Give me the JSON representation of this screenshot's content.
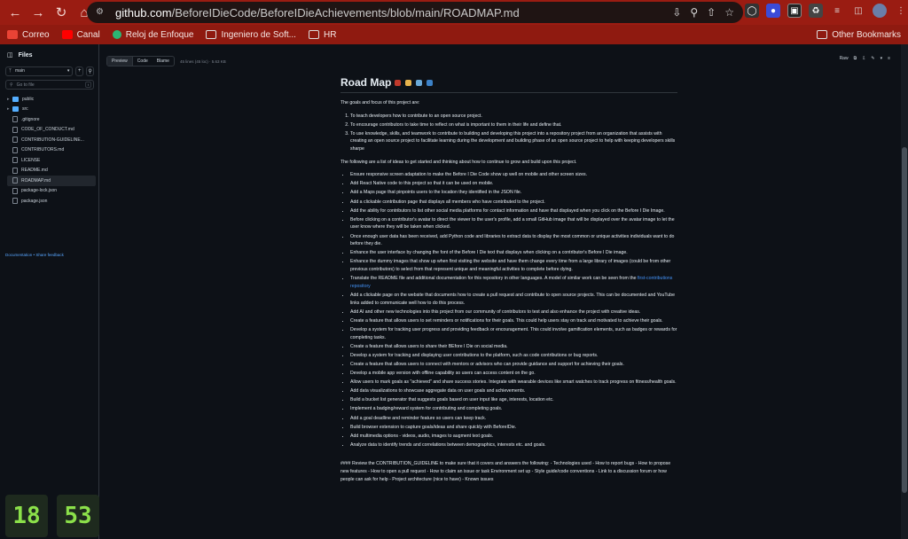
{
  "browser": {
    "url_host": "github.com",
    "url_path": "/BeforeIDieCode/BeforeIDieAchievements/blob/main/ROADMAP.md",
    "bookmarks": [
      {
        "label": "Correo",
        "color": "#ea4335"
      },
      {
        "label": "Canal",
        "color": "#ff0000"
      },
      {
        "label": "Reloj de Enfoque",
        "color": "#2bb673"
      },
      {
        "label": "Ingeniero de Soft...",
        "color": "#c9c9c9"
      },
      {
        "label": "HR",
        "color": "#c9c9c9"
      }
    ],
    "other_bookmarks": "Other Bookmarks"
  },
  "sidebar": {
    "title": "Files",
    "branch": "main",
    "goto_placeholder": "Go to file",
    "goto_shortcut": "t",
    "tree": [
      {
        "label": "public",
        "type": "dir"
      },
      {
        "label": "src",
        "type": "dir"
      },
      {
        "label": ".gitignore",
        "type": "file"
      },
      {
        "label": "CODE_OF_CONDUCT.md",
        "type": "file"
      },
      {
        "label": "CONTRIBUTION-GUIDELINE...",
        "type": "file"
      },
      {
        "label": "CONTRIBUTORS.md",
        "type": "file"
      },
      {
        "label": "LICENSE",
        "type": "file"
      },
      {
        "label": "README.md",
        "type": "file"
      },
      {
        "label": "ROADMAP.md",
        "type": "file",
        "active": true
      },
      {
        "label": "package-lock.json",
        "type": "file"
      },
      {
        "label": "package.json",
        "type": "file"
      }
    ],
    "links": "Documentation • Share feedback"
  },
  "clock": {
    "hours": "18",
    "minutes": "53"
  },
  "filebar": {
    "tabs": [
      "Preview",
      "Code",
      "Blame"
    ],
    "meta": "45 lines (45 loc) · 5.63 KB",
    "raw": "Raw"
  },
  "doc": {
    "title": "Road Map",
    "intro": "The goals and focus of this project are:",
    "goals": [
      "To teach developers how to contribute to an open source project.",
      "To encourage contributors to take time to reflect on what is important to them in their life and define that.",
      "To use knowledge, skills, and teamwork to contribute to building and developing this project into a repository project from an organization that assists with creating an open source project to facilitate learning during the development and building phase of an open source project to help with keeping developers skills sharpe"
    ],
    "ideas_intro": "The following are a list of ideas to get started and thinking about how to continue to grow and build upon this project.",
    "ideas": [
      "Ensure responsive screen adaptation to make the Before I Die Code show up well on mobile and other screen sizes.",
      "Add React Native code to this project so that it can be used on mobile.",
      "Add a Maps page that pinpoints users to the location they identified in the JSON file.",
      "Add a clickable contribution page that displays all members who have contributed to the project.",
      "Add the ability for contributors to list other social media platforms for contact information and have that displayed when you click on the Before I Die Image.",
      "Before clicking on a contributor's avatar to direct the viewer to the user's profile, add a small GitHub image that will be displayed over the avatar image to let the user know where they will be taken when clicked.",
      "Once enough user data has been received, add Python code and libraries to extract data to display the most common or unique activities individuals want to do before they die.",
      "Enhance the user interface by changing the font of the Before I Die text that displays when clicking on a contributor's Before I Die image.",
      "Enhance the dummy images that show up when first visiting the website and have them change every time from a large library of images (could be from other previous contributors) to select from that represent unique and meaningful activities to complete before dying."
    ],
    "translate_text": "Translate the README file and additional documentation for this repository in other languages. A model of similar work can be seen from the ",
    "translate_link": "first-contributions repository",
    "ideas2": [
      "Add a clickable page on the website that documents how to create a pull request and contribute to open source projects. This can be documented and YouTube links added to communicate well how to do this process.",
      "Add AI and other new technologies into this project from our community of contributors to test and also enhance the project with creative ideas.",
      "Create a feature that allows users to set reminders or notifications for their goals. This could help users stay on track and motivated to achieve their goals.",
      "Develop a system for tracking user progress and providing feedback or encouragement. This could involve gamification elements, such as badges or rewards for completing tasks.",
      "Create a feature that allows users to share their BEfore I Die on social media.",
      "Develop a system for tracking and displaying user contributions to the platform, such as code contributions or bug reports.",
      "Create a feature that allows users to connect with mentors or advisors who can provide guidance and support for achieving their goals.",
      "Develop a mobile app version with offline capability so users can access content on the go.",
      "Allow users to mark goals as \"achieved\" and share success stories. Integrate with wearable devices like smart watches to track progress on fitness/health goals.",
      "Add data visualizations to showcase aggregate data on user goals and achievements.",
      "Build a bucket list generator that suggests goals based on user input like age, interests, location etc.",
      "Implement a badging/reward system for contributing and completing goals.",
      "Add a goal deadline and reminder feature so users can keep track.",
      "Build browser extension to capture goals/ideas and share quickly with BeforeIDie.",
      "Add multimedia options - videos, audio, images to augment text goals.",
      "Analyze data to identify trends and correlations between demographics, interests etc. and goals."
    ],
    "footer": "#### Review the CONTRIBUTION_GUIDELINE to make sure that it covers and answers the following: - Technologies used - How to report bugs - How to propose new features - How to open a pull request - How to claim an issue or task Environment set up - Style guide/code conventions - Link to a discussion forum or how people can ask for help - Project architecture (nice to have) - Known issues"
  }
}
